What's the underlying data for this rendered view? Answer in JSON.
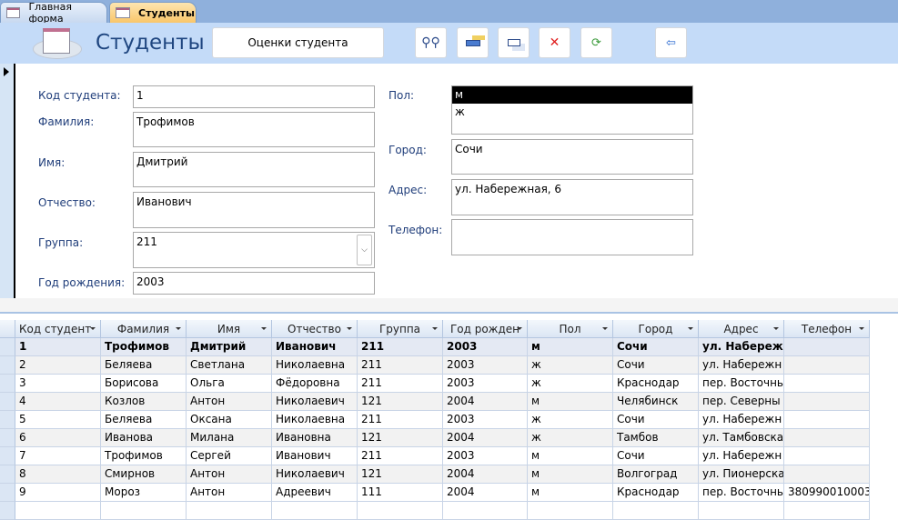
{
  "tabs": [
    {
      "label": "Главная форма",
      "active": false
    },
    {
      "label": "Студенты",
      "active": true
    }
  ],
  "header": {
    "title": "Студенты",
    "grades_button": "Оценки студента",
    "tools": [
      {
        "icon": "binoculars-icon",
        "name": "find-button"
      },
      {
        "icon": "new-record-icon",
        "name": "new-record-button"
      },
      {
        "icon": "copy-record-icon",
        "name": "duplicate-record-button"
      },
      {
        "icon": "delete-record-icon",
        "name": "delete-record-button"
      },
      {
        "icon": "refresh-icon",
        "name": "refresh-button"
      },
      {
        "icon": "exit-door-icon",
        "name": "close-form-button"
      }
    ]
  },
  "form": {
    "student_id": {
      "label": "Код студента:",
      "value": "1"
    },
    "last_name": {
      "label": "Фамилия:",
      "value": "Трофимов"
    },
    "first_name": {
      "label": "Имя:",
      "value": "Дмитрий"
    },
    "middle_name": {
      "label": "Отчество:",
      "value": "Иванович"
    },
    "group": {
      "label": "Группа:",
      "value": "211"
    },
    "birth_year": {
      "label": "Год рождения:",
      "value": "2003"
    },
    "gender": {
      "label": "Пол:",
      "options": [
        "м",
        "ж"
      ],
      "selected": "м"
    },
    "city": {
      "label": "Город:",
      "value": "Сочи"
    },
    "address": {
      "label": "Адрес:",
      "value": "ул. Набережная, 6"
    },
    "phone": {
      "label": "Телефон:",
      "value": ""
    }
  },
  "grid": {
    "columns": [
      "Код студент",
      "Фамилия",
      "Имя",
      "Отчество",
      "Группа",
      "Год рожден",
      "Пол",
      "Город",
      "Адрес",
      "Телефон"
    ],
    "rows": [
      [
        "1",
        "Трофимов",
        "Дмитрий",
        "Иванович",
        "211",
        "2003",
        "м",
        "Сочи",
        "ул. Набережн",
        ""
      ],
      [
        "2",
        "Беляева",
        "Светлана",
        "Николаевна",
        "211",
        "2003",
        "ж",
        "Сочи",
        "ул. Набережн",
        ""
      ],
      [
        "3",
        "Борисова",
        "Ольга",
        "Фёдоровна",
        "211",
        "2003",
        "ж",
        "Краснодар",
        "пер. Восточнь",
        ""
      ],
      [
        "4",
        "Козлов",
        "Антон",
        "Николаевич",
        "121",
        "2004",
        "м",
        "Челябинск",
        "пер. Северны",
        ""
      ],
      [
        "5",
        "Беляева",
        "Оксана",
        "Николаевна",
        "211",
        "2003",
        "ж",
        "Сочи",
        "ул. Набережн",
        ""
      ],
      [
        "6",
        "Иванова",
        "Милана",
        "Ивановна",
        "121",
        "2004",
        "ж",
        "Тамбов",
        "ул.  Тамбовска",
        ""
      ],
      [
        "7",
        "Трофимов",
        "Сергей",
        "Иванович",
        "211",
        "2003",
        "м",
        "Сочи",
        "ул. Набережн",
        ""
      ],
      [
        "8",
        "Смирнов",
        "Антон",
        "Николаевич",
        "121",
        "2004",
        "м",
        "Волгоград",
        "ул. Пионерска",
        ""
      ],
      [
        "9",
        "Мороз",
        "Антон",
        "Адреевич",
        "111",
        "2004",
        "м",
        "Краснодар",
        "пер. Восточнь",
        "380990010003"
      ]
    ]
  },
  "colors": {
    "label": "#1f3d7a",
    "header_bg": "#c4dbf8",
    "active_tab": "#fcd58a"
  }
}
